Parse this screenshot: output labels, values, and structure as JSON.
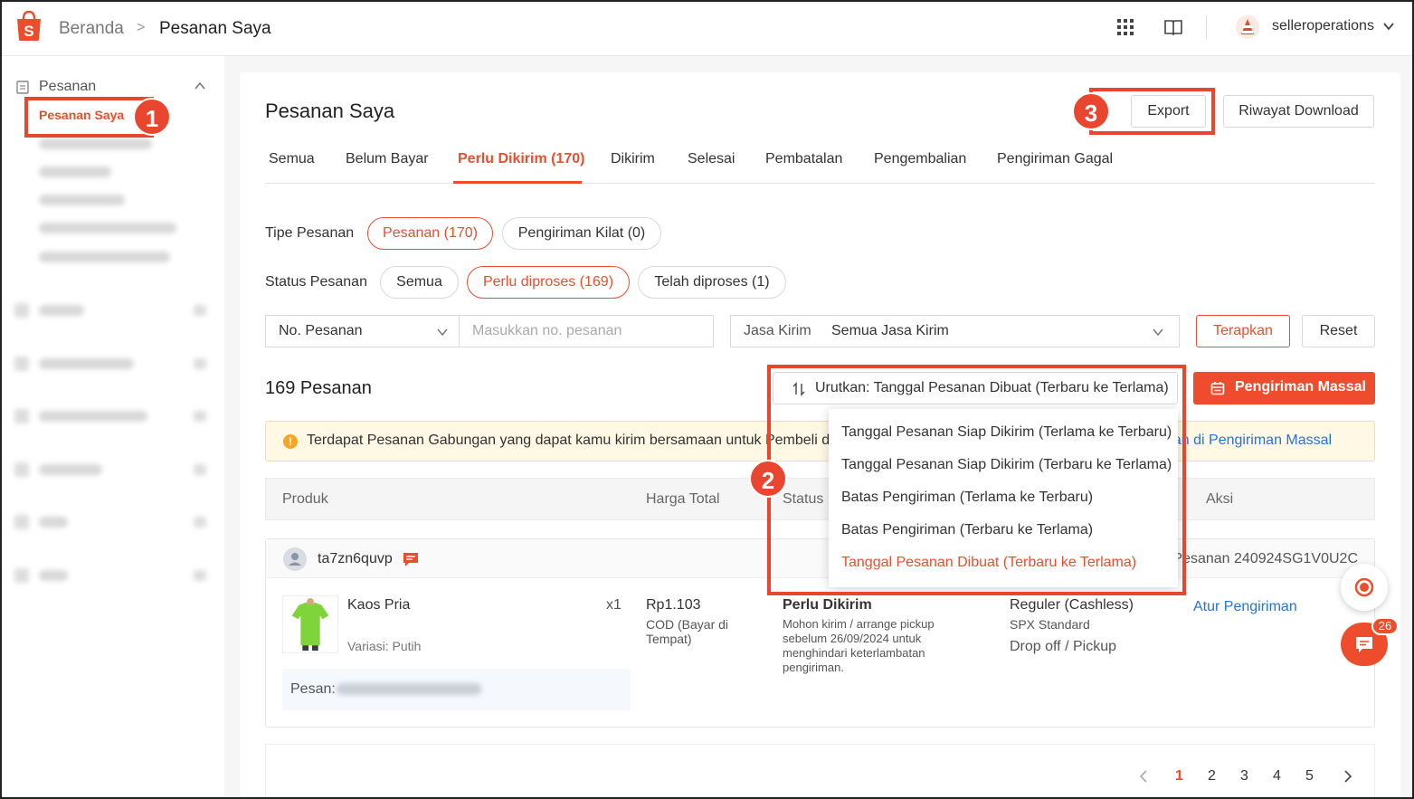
{
  "header": {
    "breadcrumb_home": "Beranda",
    "breadcrumb_current": "Pesanan Saya",
    "username": "selleroperations",
    "brand_color": "#ee4d2d"
  },
  "sidebar": {
    "section_label": "Pesanan",
    "active_item": "Pesanan Saya"
  },
  "page": {
    "title": "Pesanan Saya",
    "export_label": "Export",
    "history_label": "Riwayat Download"
  },
  "tabs": [
    {
      "label": "Semua"
    },
    {
      "label": "Belum Bayar"
    },
    {
      "label": "Perlu Dikirim (170)"
    },
    {
      "label": "Dikirim"
    },
    {
      "label": "Selesai"
    },
    {
      "label": "Pembatalan"
    },
    {
      "label": "Pengembalian"
    },
    {
      "label": "Pengiriman Gagal"
    }
  ],
  "filters": {
    "order_type_label": "Tipe Pesanan",
    "order_type_options": [
      "Pesanan (170)",
      "Pengiriman Kilat (0)"
    ],
    "order_status_label": "Status Pesanan",
    "order_status_options": [
      "Semua",
      "Perlu diproses (169)",
      "Telah diproses (1)"
    ],
    "search_by": "No. Pesanan",
    "search_placeholder": "Masukkan no. pesanan",
    "courier_label": "Jasa Kirim",
    "courier_value": "Semua Jasa Kirim",
    "apply_label": "Terapkan",
    "reset_label": "Reset"
  },
  "list": {
    "count_label": "169 Pesanan",
    "sort_label": "Urutkan: Tanggal Pesanan Dibuat (Terbaru ke Terlama)",
    "mass_ship_label": "Pengiriman Massal",
    "notice_text": "Terdapat Pesanan Gabungan yang dapat kamu kirim bersamaan untuk Pembeli dar",
    "notice_link": "gan di Pengiriman Massal",
    "columns": [
      "Produk",
      "Harga Total",
      "Status",
      "Aksi"
    ]
  },
  "sort_dropdown": {
    "options": [
      "Tanggal Pesanan Siap Dikirim (Terlama ke Terbaru)",
      "Tanggal Pesanan Siap Dikirim (Terbaru ke Terlama)",
      "Batas Pengiriman (Terlama ke Terbaru)",
      "Batas Pengiriman (Terbaru ke Terlama)",
      "Tanggal Pesanan Dibuat (Terbaru ke Terlama)"
    ],
    "selected_index": 4
  },
  "order": {
    "buyer": "ta7zn6quvp",
    "order_no": "Pesanan 240924SG1V0U2C",
    "product_name": "Kaos Pria",
    "variation": "Variasi: Putih",
    "qty": "x1",
    "price": "Rp1.103",
    "payment": "COD (Bayar di Tempat)",
    "status": "Perlu Dikirim",
    "status_desc": "Mohon kirim / arrange pickup sebelum 26/09/2024 untuk menghindari keterlambatan pengiriman.",
    "shipping": "Reguler (Cashless)",
    "courier": "SPX Standard",
    "ship_method": "Drop off / Pickup",
    "action": "Atur Pengiriman",
    "note_label": "Pesan:"
  },
  "pagination": {
    "pages": [
      "1",
      "2",
      "3",
      "4",
      "5"
    ],
    "current": "1"
  },
  "annotations": [
    "1",
    "2",
    "3"
  ],
  "chat_badge": "26"
}
